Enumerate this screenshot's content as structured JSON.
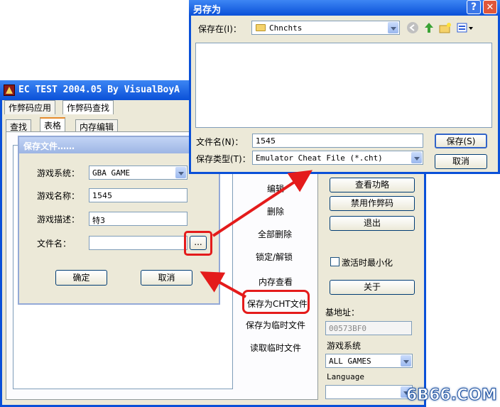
{
  "main_window": {
    "title": "EC TEST 2004.05  By VisualBoyA",
    "tabs_row1": [
      "作弊码应用",
      "作弊码查找"
    ],
    "tabs_row2": [
      "查找",
      "表格",
      "内存编辑"
    ],
    "middle_actions": [
      "编辑",
      "删除",
      "全部删除",
      "锁定/解锁",
      "内存查看",
      "保存为CHT文件",
      "保存为临时文件",
      "读取临时文件"
    ],
    "right_buttons": [
      "查看功略",
      "禁用作弊码",
      "退出"
    ],
    "minimize_checkbox_label": "激活时最小化",
    "about_button": "关于",
    "base_address_label": "基地址：",
    "base_address_value": "00573BF0",
    "game_system_label": "游戏系统",
    "game_system_value": "ALL GAMES",
    "language_label": "Language",
    "language_value": ""
  },
  "save_dialog": {
    "title": "保存文件……",
    "system_label": "游戏系统：",
    "system_value": "GBA GAME",
    "name_label": "游戏名称：",
    "name_value": "1545",
    "desc_label": "游戏描述：",
    "desc_value": "特3",
    "file_label": "文件名：",
    "file_value": "",
    "browse_label": "...",
    "ok_button": "确定",
    "cancel_button": "取消"
  },
  "saveas_dialog": {
    "title": "另存为",
    "save_in_label": "保存在(I)：",
    "save_in_value": "Chnchts",
    "filename_label": "文件名(N)：",
    "filename_value": "1545",
    "filetype_label": "保存类型(T)：",
    "filetype_value": "Emulator Cheat File (*.cht)",
    "save_button": "保存(S)",
    "cancel_button": "取消",
    "help_glyph": "?",
    "close_glyph": "✕"
  },
  "watermark": "6B66.COM",
  "colors": {
    "highlight_red": "#e41b1b",
    "title_blue": "#0a5ce2",
    "window_bg": "#ece9d8"
  }
}
